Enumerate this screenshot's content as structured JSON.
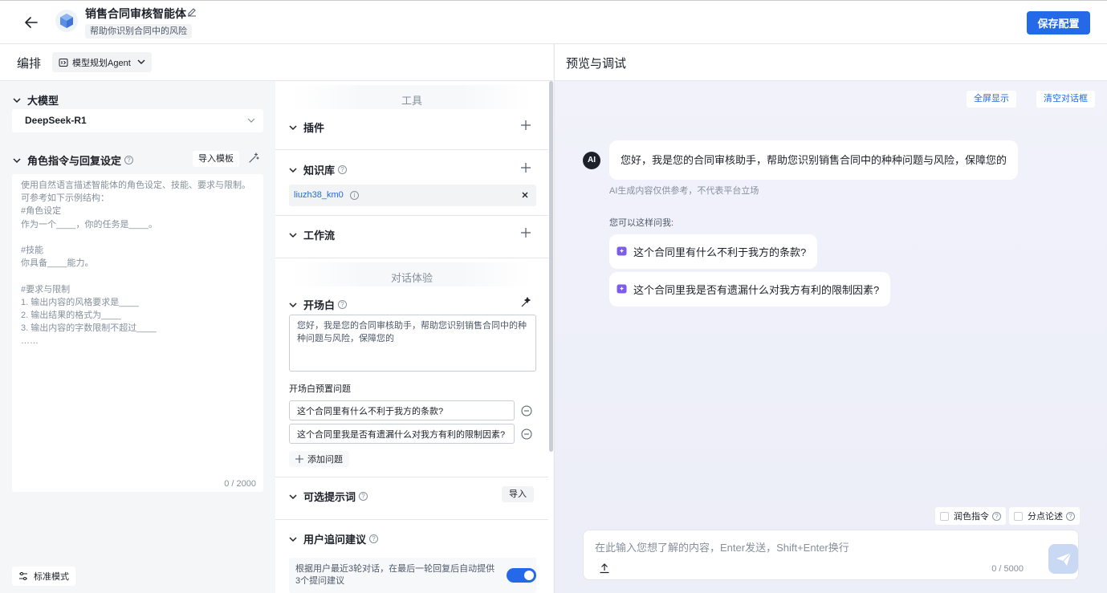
{
  "header": {
    "agent_name": "销售合同审核智能体",
    "agent_desc": "帮助你识别合同中的风险",
    "save_label": "保存配置"
  },
  "orchestration": {
    "title": "编排",
    "mode": "模型规划Agent"
  },
  "preview": {
    "title": "预览与调试",
    "fullscreen_label": "全屏显示",
    "clear_label": "清空对话框",
    "ai_avatar_text": "AI",
    "greeting": "您好，我是您的合同审核助手，帮助您识别销售合同中的种种问题与风险，保障您的",
    "ai_note": "AI生成内容仅供参考，不代表平台立场",
    "ask_label": "您可以这样问我:",
    "suggestions": [
      "这个合同里有什么不利于我方的条款?",
      "这个合同里我是否有遗漏什么对我方有利的限制因素?"
    ],
    "polish_label": "润色指令",
    "points_label": "分点论述",
    "input_placeholder": "在此输入您想了解的内容，Enter发送，Shift+Enter换行",
    "counter": "0 / 5000"
  },
  "model": {
    "title": "大模型",
    "selected": "DeepSeek-R1"
  },
  "prompt": {
    "title": "角色指令与回复设定",
    "import_label": "导入模板",
    "placeholder": "使用自然语言描述智能体的角色设定、技能、要求与限制。\n可参考如下示例结构：\n#角色设定\n作为一个____，你的任务是____。\n\n#技能\n你具备____能力。\n\n#要求与限制\n1. 输出内容的风格要求是____\n2. 输出结果的格式为____\n3. 输出内容的字数限制不超过____\n……",
    "counter": "0 / 2000"
  },
  "footer": {
    "mode_label": "标准模式"
  },
  "tools": {
    "group_label": "工具",
    "plugin_label": "插件",
    "kb_label": "知识库",
    "kb_item": "liuzh38_km0",
    "workflow_label": "工作流"
  },
  "dialog": {
    "group_label": "对话体验",
    "opening_label": "开场白",
    "opening_text": "您好，我是您的合同审核助手，帮助您识别销售合同中的种种问题与风险，保障您的",
    "preset_label": "开场白预置问题",
    "presets": [
      "这个合同里有什么不利于我方的条款?",
      "这个合同里我是否有遗漏什么对我方有利的限制因素?"
    ],
    "add_label": "添加问题",
    "optional_label": "可选提示词",
    "import_label": "导入",
    "follow_label": "用户追问建议",
    "follow_text": "根据用户最近3轮对话，在最后一轮回复后自动提供3个提问建议",
    "follow_enabled": true
  },
  "colors": {
    "primary": "#2469e8"
  }
}
